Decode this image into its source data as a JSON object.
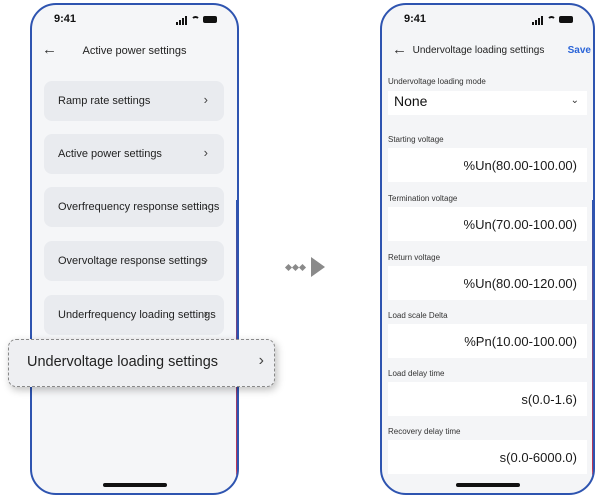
{
  "left_phone": {
    "status_time": "9:41",
    "title": "Active power settings",
    "items": [
      {
        "label": "Ramp rate settings"
      },
      {
        "label": "Active power settings"
      },
      {
        "label": "Overfrequency response settings"
      },
      {
        "label": "Overvoltage response settings"
      },
      {
        "label": "Underfrequency loading settings"
      }
    ],
    "highlighted_item": {
      "label": "Undervoltage loading settings"
    }
  },
  "right_phone": {
    "status_time": "9:41",
    "title": "Undervoltage loading settings",
    "save_label": "Save",
    "mode_label": "Undervoltage loading mode",
    "mode_value": "None",
    "fields": [
      {
        "label": "Starting voltage",
        "value": "%Un(80.00-100.00)"
      },
      {
        "label": "Termination voltage",
        "value": "%Un(70.00-100.00)"
      },
      {
        "label": "Return voltage",
        "value": "%Un(80.00-120.00)"
      },
      {
        "label": "Load scale Delta",
        "value": "%Pn(10.00-100.00)"
      },
      {
        "label": "Load delay time",
        "value": "s(0.0-1.6)"
      },
      {
        "label": "Recovery delay time",
        "value": "s(0.0-6000.0)"
      }
    ]
  },
  "icons": {
    "back": "back-arrow-icon",
    "chevron": "chevron-right-icon",
    "dropdown": "chevron-down-icon",
    "transition": "arrow-right-icon"
  },
  "colors": {
    "frame": "#2e54b0",
    "frame_accent": "#c8324f",
    "save": "#2a64d8"
  }
}
